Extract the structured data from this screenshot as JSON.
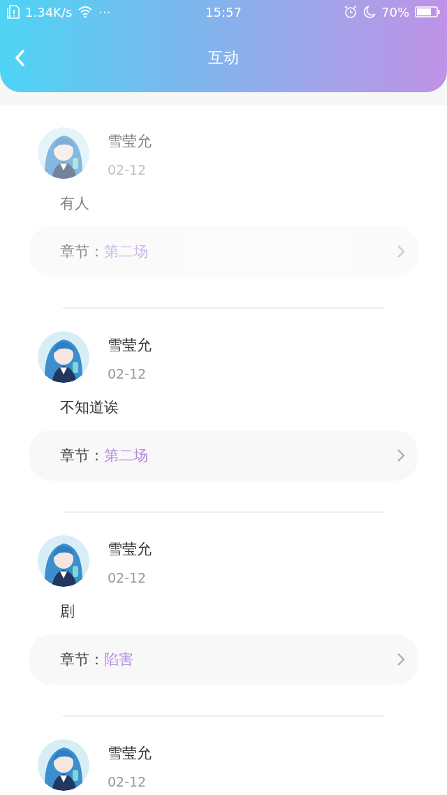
{
  "status_bar": {
    "net_speed": "1.34K/s",
    "more": "···",
    "time": "15:57",
    "battery_percent": "70%"
  },
  "header": {
    "title": "互动"
  },
  "items": [
    {
      "faded": true,
      "name": "雪莹允",
      "date": "02-12",
      "text": "有人",
      "chapter_label": "章节：",
      "chapter": "第二场"
    },
    {
      "faded": false,
      "name": "雪莹允",
      "date": "02-12",
      "text": "不知道诶",
      "chapter_label": "章节：",
      "chapter": "第二场"
    },
    {
      "faded": false,
      "name": "雪莹允",
      "date": "02-12",
      "text": "剧",
      "chapter_label": "章节：",
      "chapter": "陷害"
    },
    {
      "faded": false,
      "name": "雪莹允",
      "date": "02-12"
    }
  ]
}
